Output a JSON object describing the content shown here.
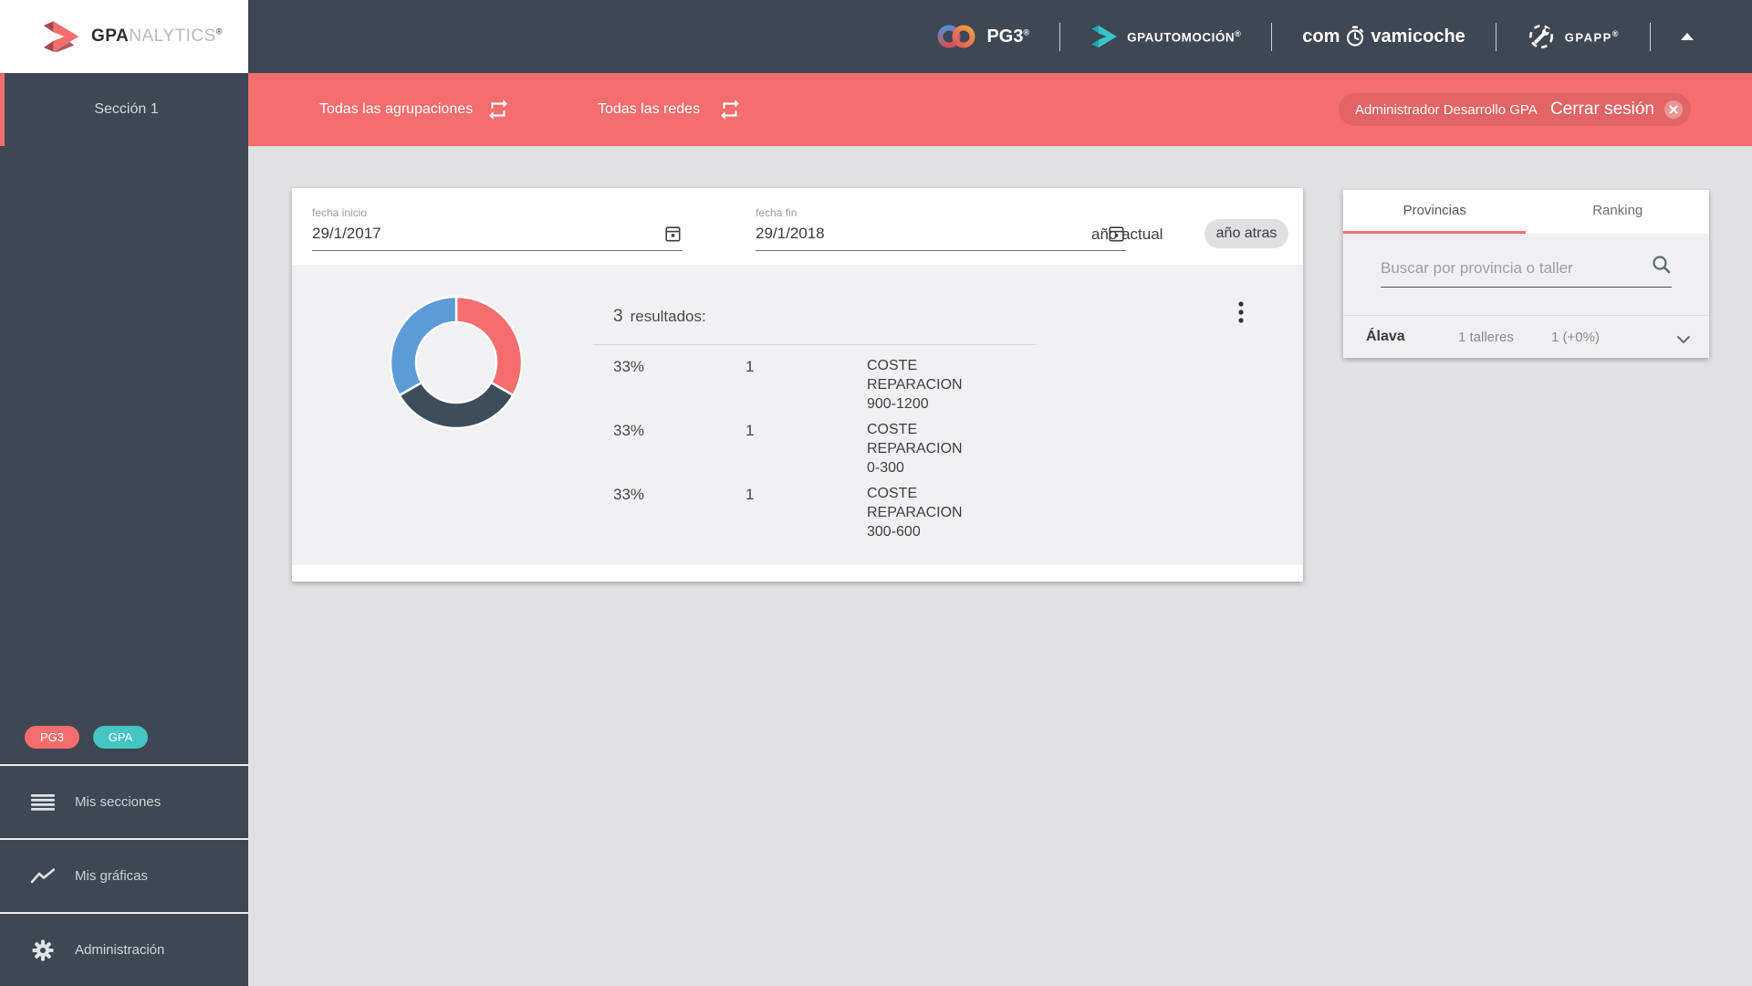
{
  "logo": {
    "bold": "GPA",
    "light": "NALYTICS",
    "reg": "®"
  },
  "topbar": {
    "pg3": {
      "label": "PG3",
      "reg": "®"
    },
    "gpautomocion": {
      "bold": "GPA",
      "rest": "UTOMOCIÓN",
      "reg": "®"
    },
    "comprovamicoche": {
      "pre": "com",
      "post": "vamicoche"
    },
    "gpapp": {
      "label": "GPAPP",
      "reg": "®"
    }
  },
  "filterbar": {
    "agrupaciones": "Todas las agrupaciones",
    "redes": "Todas las redes",
    "usuario": "Administrador Desarrollo GPA",
    "logout": "Cerrar sesión"
  },
  "sidebar": {
    "seccion": "Sección 1",
    "badges": [
      {
        "label": "PG3"
      },
      {
        "label": "GPA"
      }
    ],
    "items": [
      {
        "label": "Mis secciones"
      },
      {
        "label": "Mis gráficas"
      },
      {
        "label": "Administración"
      }
    ]
  },
  "card": {
    "fecha_inicio": {
      "label": "fecha inicio",
      "value": "29/1/2017"
    },
    "fecha_fin": {
      "label": "fecha fin",
      "value": "29/1/2018"
    },
    "ano_actual": "año actual",
    "ano_atras": "año atras",
    "resultados_count": "3",
    "resultados_label": "resultados:",
    "rows": [
      {
        "percent": "33%",
        "count": "1",
        "label": "COSTE REPARACION 900-1200"
      },
      {
        "percent": "33%",
        "count": "1",
        "label": "COSTE REPARACION 0-300"
      },
      {
        "percent": "33%",
        "count": "1",
        "label": "COSTE REPARACION 300-600"
      }
    ]
  },
  "chart_data": {
    "type": "pie",
    "donut": true,
    "title": "",
    "labels": [
      "COSTE REPARACION 900-1200",
      "COSTE REPARACION 0-300",
      "COSTE REPARACION 300-600"
    ],
    "values": [
      33.33,
      33.33,
      33.34
    ],
    "counts": [
      1,
      1,
      1
    ],
    "colors": [
      "#f66d6d",
      "#3d4d5c",
      "#5b9bd8"
    ],
    "start_angle_deg": 0,
    "legend_position": "right-list"
  },
  "panel": {
    "tabs": [
      {
        "label": "Provincias"
      },
      {
        "label": "Ranking"
      }
    ],
    "search_placeholder": "Buscar por provincia o taller",
    "rows": [
      {
        "name": "Álava",
        "talleres": "1 talleres",
        "value": "1 (+0%)"
      }
    ]
  },
  "colors": {
    "accent_red": "#f66d6d",
    "header_slate": "#3e4753",
    "teal_badge": "#45c5c3",
    "teal_logo": "#35c4c8",
    "page_bg": "#e1e1e4",
    "section_bg": "#f1f1f3",
    "chart_blue": "#5b9bd8",
    "chart_dark": "#3d4d5c"
  }
}
